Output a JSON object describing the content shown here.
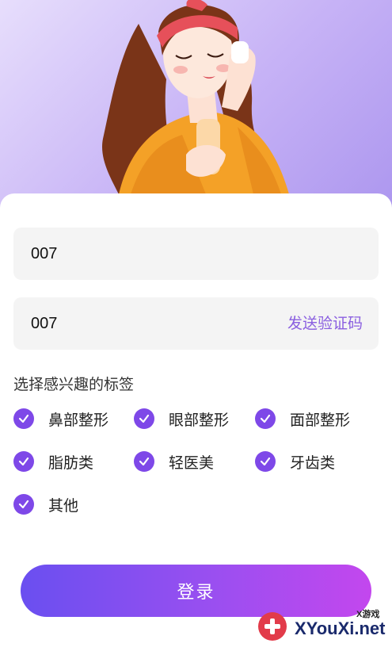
{
  "form": {
    "account_value": "007",
    "code_value": "007",
    "send_code_label": "发送验证码"
  },
  "tags": {
    "title": "选择感兴趣的标签",
    "items": [
      {
        "label": "鼻部整形",
        "checked": true
      },
      {
        "label": "眼部整形",
        "checked": true
      },
      {
        "label": "面部整形",
        "checked": true
      },
      {
        "label": "脂肪类",
        "checked": true
      },
      {
        "label": "轻医美",
        "checked": true
      },
      {
        "label": "牙齿类",
        "checked": true
      },
      {
        "label": "其他",
        "checked": true
      }
    ]
  },
  "login": {
    "label": "登录"
  },
  "watermark": {
    "small": "X游戏",
    "site": "XYouXi.net"
  },
  "colors": {
    "accent": "#7e48e8",
    "link": "#8a5fe0",
    "button_start": "#6a4ff0",
    "button_end": "#c347ee",
    "hero_bg": "#c7b3f6"
  },
  "icons": {
    "tag_check": "check-circle-icon"
  }
}
